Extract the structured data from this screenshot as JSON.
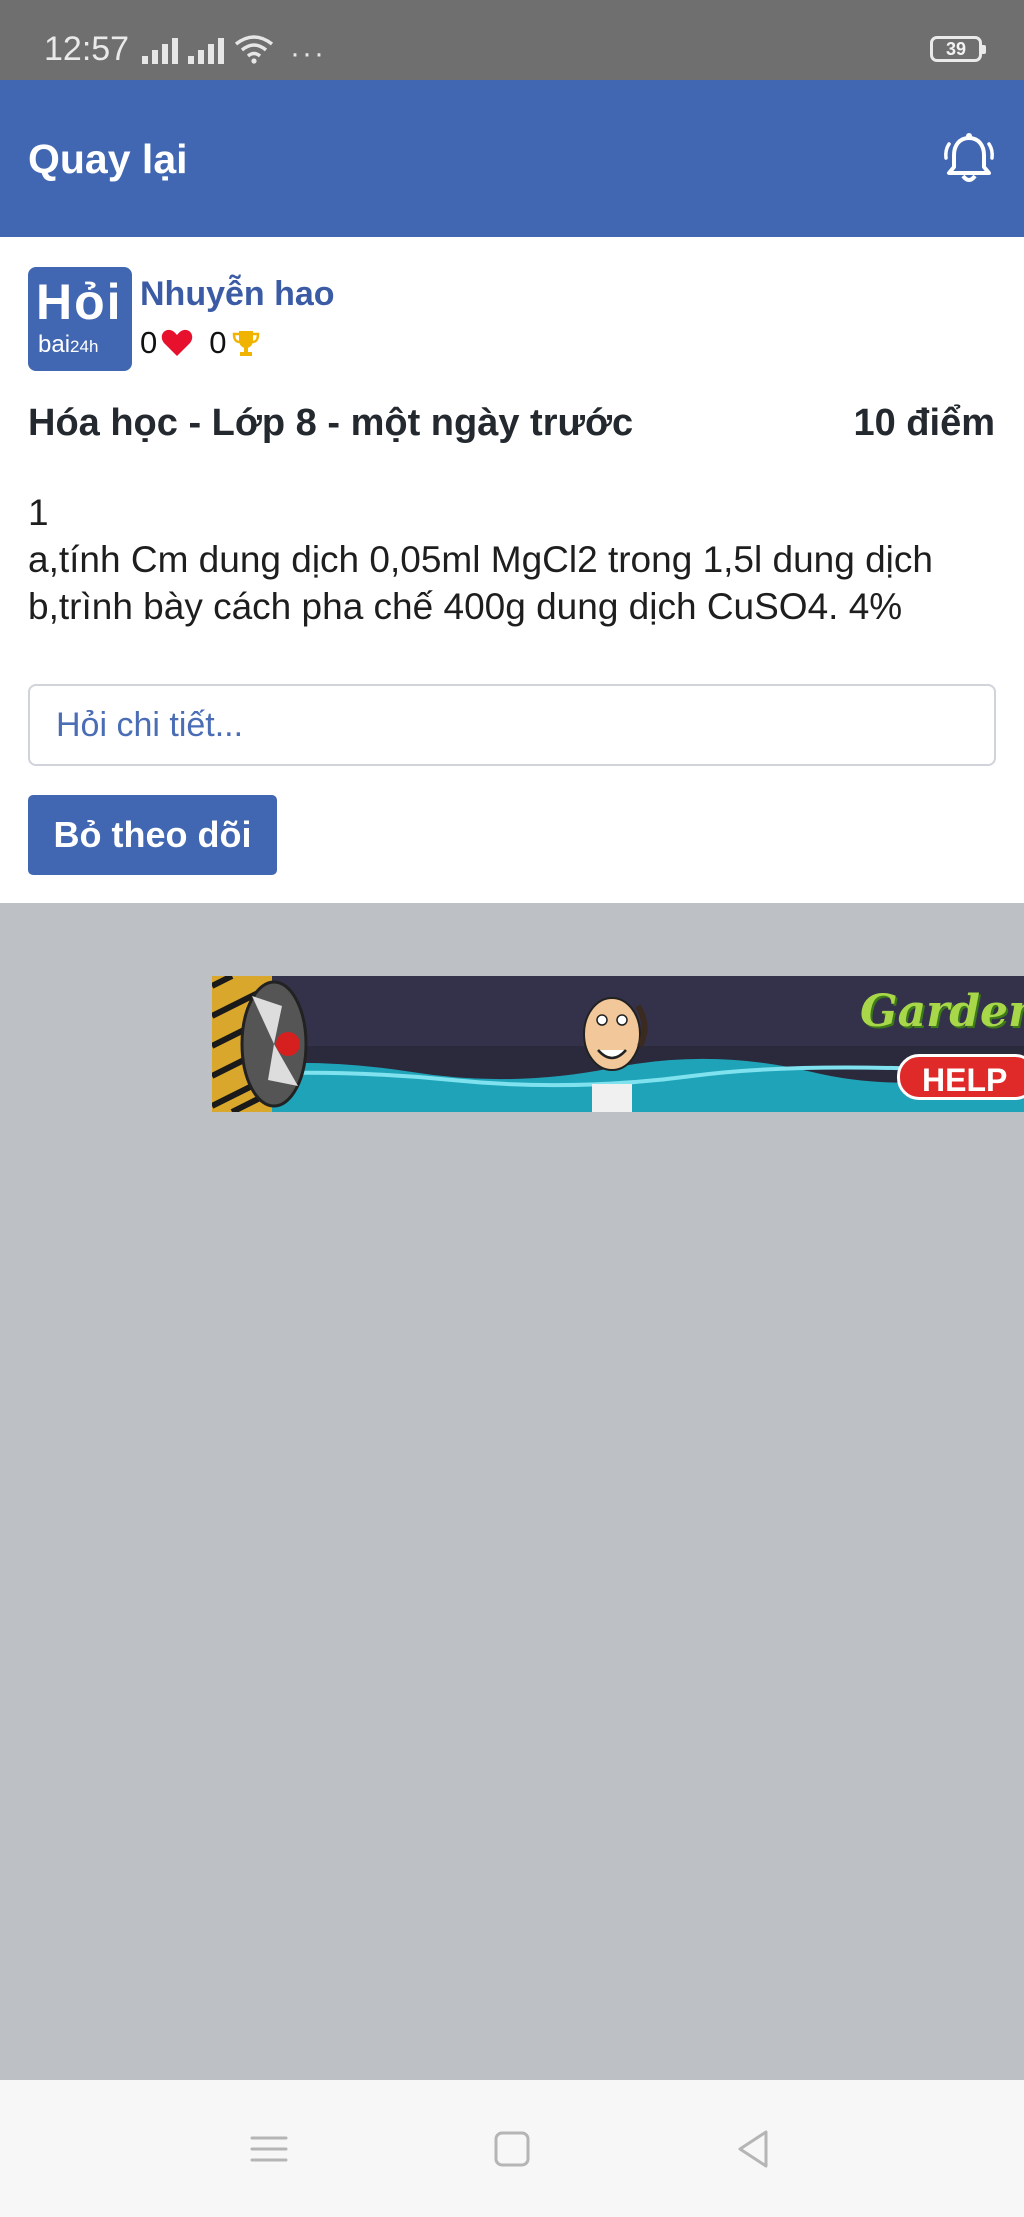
{
  "status_bar": {
    "time": "12:57",
    "battery": "39"
  },
  "app_bar": {
    "back_label": "Quay lại",
    "icon": "bell-icon"
  },
  "post": {
    "logo_text_top": "Hỏi",
    "logo_text_bottom": "bai",
    "logo_text_bottom_small": "24h",
    "username": "Nhuyễn hao",
    "likes": "0",
    "trophies": "0",
    "meta": "Hóa học - Lớp 8 - một ngày trước",
    "points": "10 điểm",
    "body_lines": [
      "1",
      "a,tính Cm dung dịch 0,05ml MgCl2 trong 1,5l dung dịch",
      "b,trình bày cách pha chế 400g dung dịch CuSO4. 4%"
    ],
    "ask_placeholder": "Hỏi chi tiết...",
    "unfollow_label": "Bỏ theo dõi"
  },
  "ad": {
    "brand": "Gardensca",
    "cta": "HELP"
  },
  "colors": {
    "primary": "#4267b2",
    "background": "#bdc1c6",
    "heart": "#e8112d",
    "trophy": "#f0b400"
  }
}
